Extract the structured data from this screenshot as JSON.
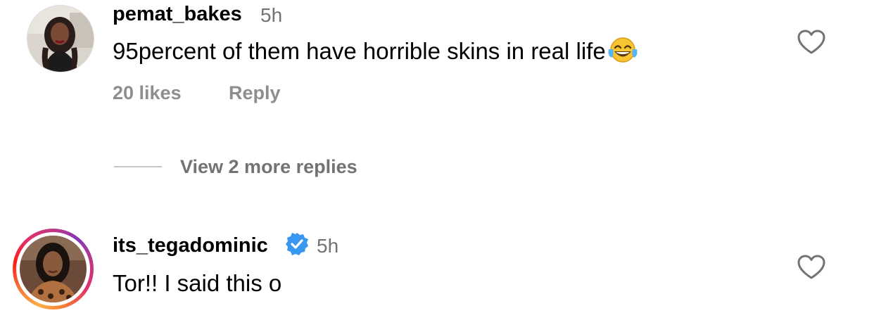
{
  "comments": [
    {
      "username": "pemat_bakes",
      "time": "5h",
      "text": "95percent of them have horrible skins in real life",
      "emoji": "face-with-tears-of-joy",
      "likes": "20 likes",
      "reply_label": "Reply",
      "verified": false
    },
    {
      "username": "its_tegadominic",
      "time": "5h",
      "text": "Tor!! I said this o",
      "verified": true,
      "has_story_ring": true
    }
  ],
  "view_replies_label": "View 2 more replies",
  "icons": {
    "like": "heart-outline-icon",
    "verified": "verified-badge-icon"
  },
  "colors": {
    "secondary_text": "#737373",
    "meta_text": "#8e8e8e",
    "verified_blue": "#3897f0"
  }
}
